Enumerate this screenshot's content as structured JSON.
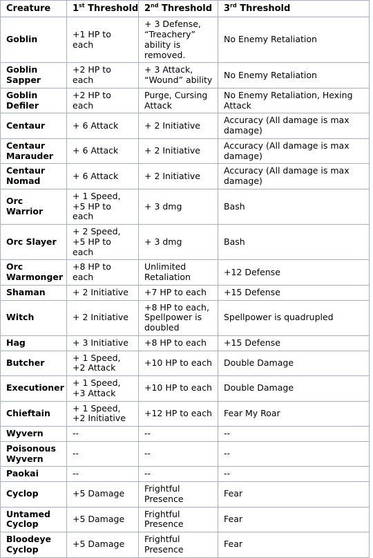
{
  "table": {
    "columns": [
      {
        "label": "Creature",
        "sup": ""
      },
      {
        "label": "1",
        "sup": "st",
        "suffix": " Threshold"
      },
      {
        "label": "2",
        "sup": "nd",
        "suffix": " Threshold"
      },
      {
        "label": "3",
        "sup": "rd",
        "suffix": " Threshold"
      }
    ],
    "headers": {
      "creature": "Creature",
      "t1_num": "1",
      "t1_sup": "st",
      "t1_rest": " Threshold",
      "t2_num": "2",
      "t2_sup": "nd",
      "t2_rest": " Threshold",
      "t3_num": "3",
      "t3_sup": "rd",
      "t3_rest": " Threshold"
    },
    "rows": [
      {
        "creature": "Goblin",
        "t1": "+1 HP to each",
        "t2": "+ 3 Defense, “Treachery” ability is removed.",
        "t3": "No Enemy Retaliation"
      },
      {
        "creature": "Goblin Sapper",
        "t1": "+2 HP to each",
        "t2": "+ 3 Attack, “Wound” ability",
        "t3": "No Enemy Retaliation"
      },
      {
        "creature": "Goblin Defiler",
        "t1": "+2 HP to each",
        "t2": "Purge, Cursing Attack",
        "t3": "No Enemy Retaliation, Hexing Attack"
      },
      {
        "creature": "Centaur",
        "t1": "+ 6 Attack",
        "t2": "+ 2 Initiative",
        "t3": "Accuracy (All damage is max damage)"
      },
      {
        "creature": "Centaur Marauder",
        "t1": "+ 6 Attack",
        "t2": "+ 2 Initiative",
        "t3": "Accuracy (All damage is max damage)"
      },
      {
        "creature": "Centaur Nomad",
        "t1": "+ 6 Attack",
        "t2": "+ 2 Initiative",
        "t3": "Accuracy (All damage is max damage)"
      },
      {
        "creature": "Orc Warrior",
        "t1": "+ 1 Speed, +5 HP to each",
        "t2": "+ 3 dmg",
        "t3": "Bash"
      },
      {
        "creature": "Orc Slayer",
        "t1": "+ 2 Speed, +5 HP to each",
        "t2": "+ 3 dmg",
        "t3": "Bash"
      },
      {
        "creature": "Orc Warmonger",
        "t1": "+8 HP to each",
        "t2": "Unlimited Retaliation",
        "t3": "+12 Defense"
      },
      {
        "creature": "Shaman",
        "t1": "+ 2 Initiative",
        "t2": "+7 HP to each",
        "t3": "+15  Defense"
      },
      {
        "creature": "Witch",
        "t1": "+ 2 Initiative",
        "t2": "+8 HP to each, Spellpower is doubled",
        "t3": "Spellpower is quadrupled"
      },
      {
        "creature": "Hag",
        "t1": "+ 3 Initiative",
        "t2": "+8 HP to each",
        "t3": "+15  Defense"
      },
      {
        "creature": "Butcher",
        "t1": "+ 1 Speed, +2 Attack",
        "t2": "+10 HP to each",
        "t3": "Double Damage"
      },
      {
        "creature": "Executioner",
        "t1": "+ 1 Speed, +3 Attack",
        "t2": "+10 HP to each",
        "t3": "Double Damage"
      },
      {
        "creature": "Chieftain",
        "t1": "+ 1 Speed, +2 Initiative",
        "t2": "+12 HP to each",
        "t3": "Fear My Roar"
      },
      {
        "creature": "Wyvern",
        "t1": "--",
        "t2": "--",
        "t3": "--"
      },
      {
        "creature": "Poisonous Wyvern",
        "t1": "--",
        "t2": "--",
        "t3": "--"
      },
      {
        "creature": "Paokai",
        "t1": "--",
        "t2": "--",
        "t3": "--"
      },
      {
        "creature": "Cyclop",
        "t1": "+5 Damage",
        "t2": "Frightful Presence",
        "t3": "Fear"
      },
      {
        "creature": "Untamed Cyclop",
        "t1": "+5 Damage",
        "t2": "Frightful Presence",
        "t3": "Fear"
      },
      {
        "creature": "Bloodeye Cyclop",
        "t1": "+5 Damage",
        "t2": "Frightful Presence",
        "t3": "Fear"
      }
    ]
  },
  "colors": {
    "border": "#a8b0c0",
    "text": "#000000",
    "background": "#ffffff"
  }
}
